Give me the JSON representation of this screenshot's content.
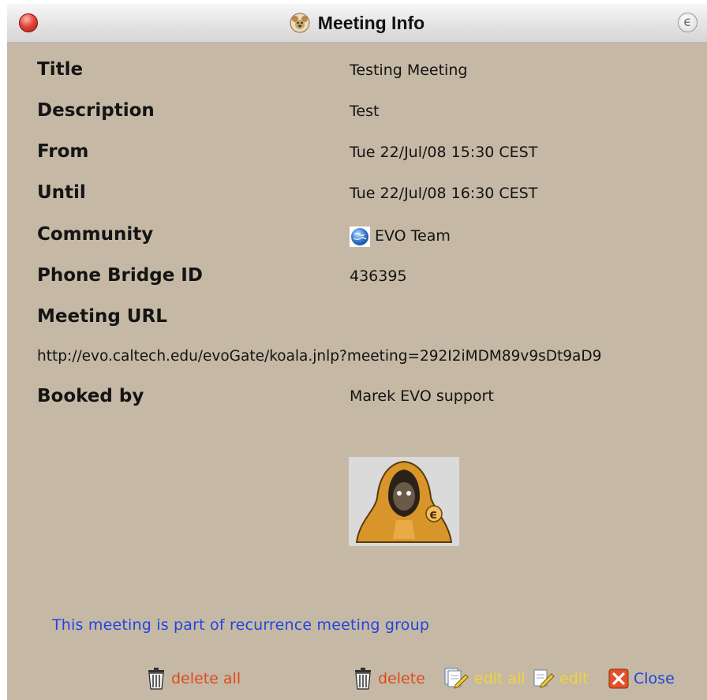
{
  "window": {
    "title": "Meeting Info",
    "title_icon": "koala-icon",
    "corner_button": "ϵ"
  },
  "fields": {
    "title": {
      "label": "Title",
      "value": "Testing Meeting"
    },
    "description": {
      "label": "Description",
      "value": "Test"
    },
    "from": {
      "label": "From",
      "value": "Tue 22/Jul/08 15:30 CEST"
    },
    "until": {
      "label": "Until",
      "value": "Tue 22/Jul/08 16:30 CEST"
    },
    "community": {
      "label": "Community",
      "value": "EVO Team",
      "icon": "globe-icon"
    },
    "phone_bridge": {
      "label": "Phone Bridge ID",
      "value": "436395"
    },
    "meeting_url": {
      "label": "Meeting URL",
      "value": "http://evo.caltech.edu/evoGate/koala.jnlp?meeting=292I2iMDM89v9sDt9aD9"
    },
    "booked_by": {
      "label": "Booked by",
      "value": "Marek EVO support"
    }
  },
  "avatar": {
    "icon": "hooded-monk-avatar"
  },
  "recurrence_note": "This meeting is part of recurrence meeting group",
  "actions": {
    "delete_all": "delete all",
    "delete": "delete",
    "edit_all": "edit all",
    "edit": "edit",
    "close": "Close"
  },
  "colors": {
    "background": "#c5b9a5",
    "link_blue": "#2244dd",
    "delete_red": "#e04a1e",
    "edit_yellow": "#f3d43a"
  }
}
